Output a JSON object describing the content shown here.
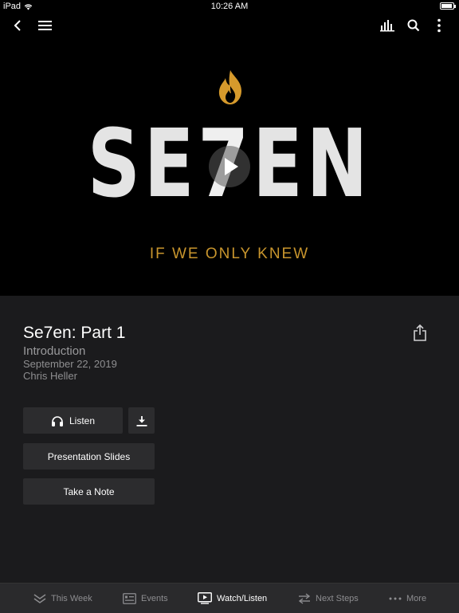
{
  "status_bar": {
    "device": "iPad",
    "time": "10:26 AM",
    "battery_level": 0.9
  },
  "nav": {
    "back_icon": "chevron-left-icon",
    "menu_icon": "hamburger-icon",
    "audio_icon": "audio-bars-icon",
    "search_icon": "search-icon",
    "more_icon": "vertical-dots-icon"
  },
  "hero": {
    "title_part1": "SE",
    "title_seven": "7",
    "title_part2": "EN",
    "subtitle": "IF WE ONLY KNEW",
    "accent_color": "#c8952d"
  },
  "sermon": {
    "title": "Se7en: Part 1",
    "subtitle": "Introduction",
    "date": "September 22, 2019",
    "speaker": "Chris Heller"
  },
  "actions": {
    "listen_label": "Listen",
    "slides_label": "Presentation Slides",
    "note_label": "Take a Note"
  },
  "tabs": [
    {
      "label": "This Week",
      "icon": "chevrons-down-icon"
    },
    {
      "label": "Events",
      "icon": "calendar-list-icon"
    },
    {
      "label": "Watch/Listen",
      "icon": "play-screen-icon"
    },
    {
      "label": "Next Steps",
      "icon": "swap-arrows-icon"
    },
    {
      "label": "More",
      "icon": "more-dots-icon"
    }
  ],
  "active_tab": "Watch/Listen"
}
